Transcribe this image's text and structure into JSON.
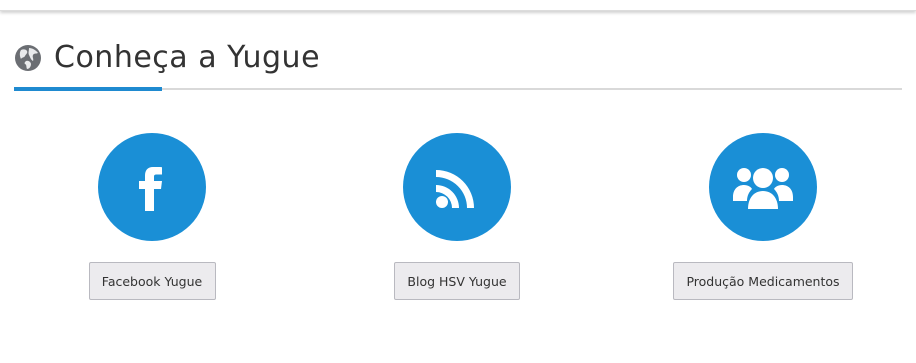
{
  "section": {
    "title": "Conheça a Yugue",
    "icon": "globe-icon"
  },
  "colors": {
    "accent": "#1f8ad0",
    "circle": "#1a8fd6",
    "button_bg": "#ecebee",
    "rule": "#d9d9d9"
  },
  "links": [
    {
      "label": "Facebook Yugue",
      "icon": "facebook-icon"
    },
    {
      "label": "Blog HSV Yugue",
      "icon": "rss-icon"
    },
    {
      "label": "Produção Medicamentos",
      "icon": "users-icon"
    }
  ]
}
